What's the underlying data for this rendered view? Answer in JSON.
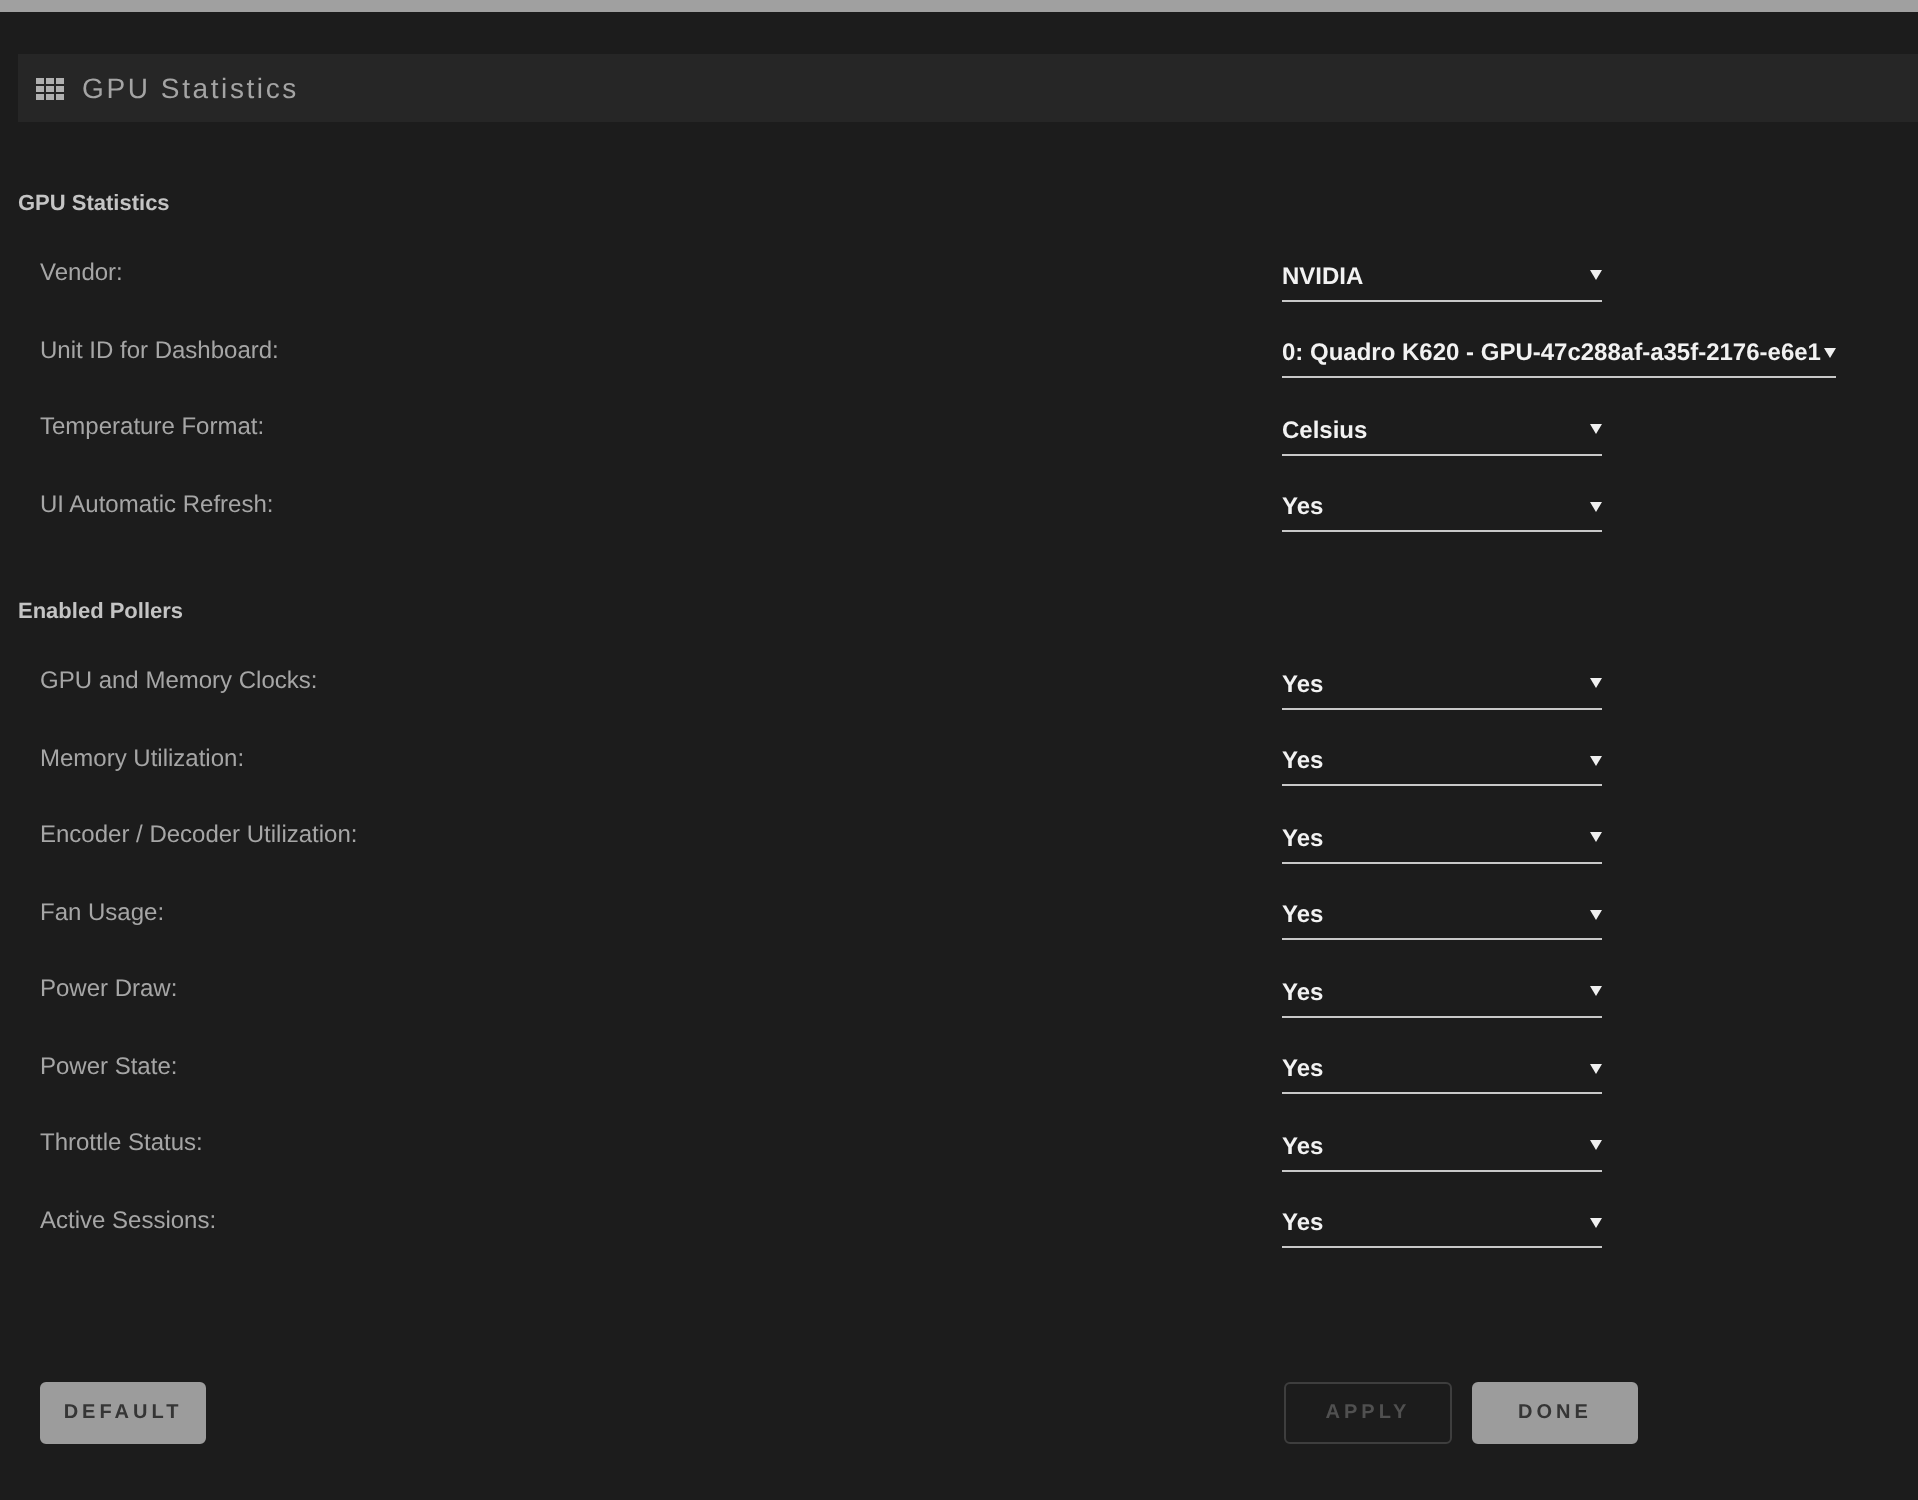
{
  "header": {
    "title": "GPU Statistics"
  },
  "sections": [
    {
      "title": "GPU Statistics",
      "settings": [
        {
          "label": "Vendor:",
          "value": "NVIDIA"
        },
        {
          "label": "Unit ID for Dashboard:",
          "value": "0: Quadro K620 - GPU-47c288af-a35f-2176-e6e1"
        },
        {
          "label": "Temperature Format:",
          "value": "Celsius"
        },
        {
          "label": "UI Automatic Refresh:",
          "value": "Yes"
        }
      ]
    },
    {
      "title": "Enabled Pollers",
      "settings": [
        {
          "label": "GPU and Memory Clocks:",
          "value": "Yes"
        },
        {
          "label": "Memory Utilization:",
          "value": "Yes"
        },
        {
          "label": "Encoder / Decoder Utilization:",
          "value": "Yes"
        },
        {
          "label": "Fan Usage:",
          "value": "Yes"
        },
        {
          "label": "Power Draw:",
          "value": "Yes"
        },
        {
          "label": "Power State:",
          "value": "Yes"
        },
        {
          "label": "Throttle Status:",
          "value": "Yes"
        },
        {
          "label": "Active Sessions:",
          "value": "Yes"
        }
      ]
    }
  ],
  "buttons": [
    {
      "label": "DEFAULT",
      "disabled": false,
      "kind": "left"
    },
    {
      "label": "APPLY",
      "disabled": true,
      "kind": "right"
    },
    {
      "label": "DONE",
      "disabled": false,
      "kind": "right"
    }
  ]
}
